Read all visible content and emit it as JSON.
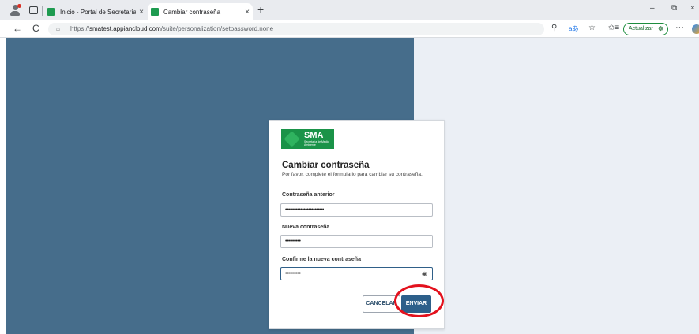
{
  "browser": {
    "tabs": [
      {
        "label": "Inicio - Portal de Secretaría de Me",
        "close": "×"
      },
      {
        "label": "Cambiar contraseña",
        "close": "×"
      }
    ],
    "new_tab": "+",
    "window_controls": {
      "minimize": "–",
      "restore": "⧉",
      "close": "×"
    },
    "address": {
      "protocol": "https://",
      "host": "smatest.appiancloud.com",
      "path": "/suite/personalization/setpassword.none"
    },
    "update_label": "Actualizar",
    "more_label": "···",
    "icons": {
      "back": "←",
      "refresh": "C",
      "lock": "⌂",
      "search": "⚲",
      "read_aloud": "aあ",
      "favorite": "☆",
      "favorites_bar": "✩≡",
      "update": "☸"
    }
  },
  "logo": {
    "name": "SMA",
    "subtitle": "Secretaría de Medio Ambiente"
  },
  "form": {
    "title": "Cambiar contraseña",
    "description": "Por favor, complete el formulario para cambiar su contraseña.",
    "fields": [
      {
        "label": "Contraseña anterior",
        "value": "•••••••••••••••••••••••••"
      },
      {
        "label": "Nueva contraseña",
        "value": "••••••••••"
      },
      {
        "label": "Confirme la nueva contraseña",
        "value": "••••••••••"
      }
    ],
    "eye_icon": "◉",
    "cancel_label": "CANCELAR",
    "submit_label": "ENVIAR"
  },
  "colors": {
    "left_panel": "#466d8b",
    "right_panel": "#ebeff5",
    "brand_green": "#1a9348",
    "primary_button": "#2d5f8a",
    "highlight": "#e3111d"
  }
}
